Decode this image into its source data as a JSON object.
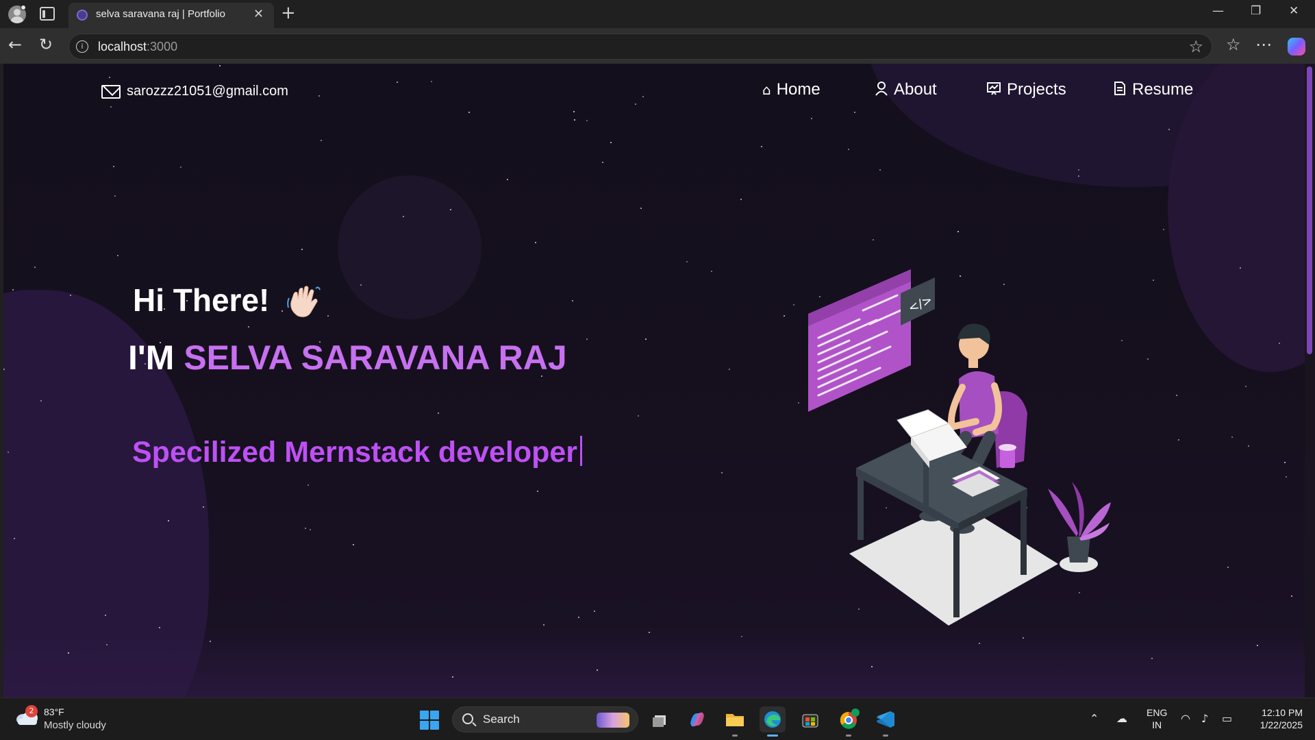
{
  "browser": {
    "tab_title": "selva saravana raj | Portfolio",
    "address_host": "localhost",
    "address_port": ":3000",
    "icons": [
      "profile-icon",
      "tab-actions-icon",
      "close-icon",
      "new-tab-icon",
      "back-icon",
      "refresh-icon",
      "info-icon",
      "favorite-star-icon",
      "favorites-icon",
      "more-icon",
      "copilot-icon",
      "minimize-icon",
      "restore-icon",
      "close-window-icon"
    ]
  },
  "page": {
    "email": "sarozzz21051@gmail.com",
    "nav": [
      {
        "label": "Home",
        "icon": "home-icon"
      },
      {
        "label": "About",
        "icon": "user-icon"
      },
      {
        "label": "Projects",
        "icon": "projects-icon"
      },
      {
        "label": "Resume",
        "icon": "document-icon"
      }
    ],
    "greeting": "Hi There!",
    "intro_prefix": "I'M ",
    "name": "SELVA SARAVANA RAJ",
    "role": "Specilized Mernstack developer",
    "colors": {
      "accent": "#c770f0",
      "role": "#be50f4",
      "background": "#140f1c"
    }
  },
  "taskbar": {
    "weather_badge": "2",
    "temperature": "83°F",
    "condition": "Mostly cloudy",
    "search_label": "Search",
    "apps": [
      "task-view-icon",
      "copilot-icon",
      "file-explorer-icon",
      "edge-icon",
      "store-icon",
      "chrome-icon",
      "vscode-icon"
    ],
    "lang_line1": "ENG",
    "lang_line2": "IN",
    "time": "12:10 PM",
    "date": "1/22/2025"
  }
}
